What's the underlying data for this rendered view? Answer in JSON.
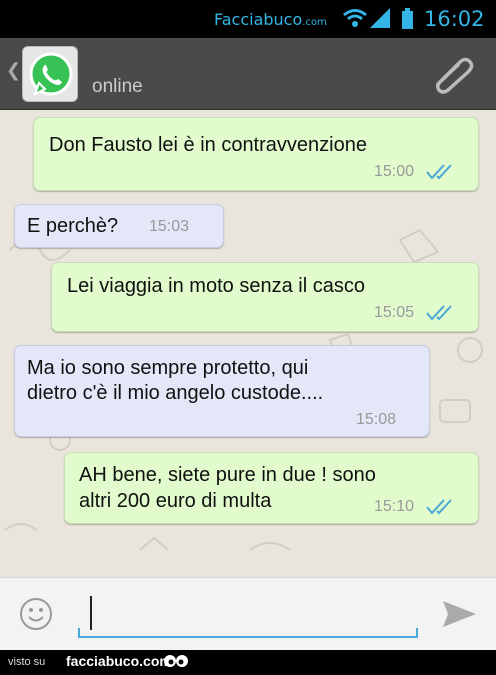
{
  "status_bar": {
    "brand": "Facciabuco",
    "brand_suffix": ".com",
    "time": "16:02",
    "accent": "#33b5e5"
  },
  "header": {
    "status": "online",
    "avatar_icon": "whatsapp-logo-icon",
    "back_icon": "chevron-left-icon",
    "attach_icon": "paperclip-icon",
    "bg": "#4a4a4a"
  },
  "messages": [
    {
      "direction": "outgoing",
      "lines": [
        "Don Fausto lei è in contravvenzione"
      ],
      "time": "15:00",
      "read": true
    },
    {
      "direction": "incoming",
      "lines": [
        "E perchè?"
      ],
      "time": "15:03"
    },
    {
      "direction": "outgoing",
      "lines": [
        "Lei viaggia in moto senza il casco"
      ],
      "time": "15:05",
      "read": true
    },
    {
      "direction": "incoming",
      "lines": [
        "Ma io sono sempre protetto, qui",
        "dietro c'è il mio angelo custode...."
      ],
      "time": "15:08"
    },
    {
      "direction": "outgoing",
      "lines": [
        "AH bene, siete pure in due ! sono",
        "altri 200 euro di multa"
      ],
      "time": "15:10",
      "read": true
    }
  ],
  "colors": {
    "outgoing_bubble": "#e1fbcd",
    "incoming_bubble": "#e3e7f7",
    "read_ticks": "#4aa8d8",
    "chat_bg": "#e9e4dc"
  },
  "input": {
    "value": "",
    "placeholder": "",
    "emoji_icon": "smiley-icon",
    "send_icon": "send-arrow-icon"
  },
  "footer": {
    "prefix": "visto su",
    "brand": "facciabuco.com",
    "logo_icon": "googly-eyes-icon"
  }
}
